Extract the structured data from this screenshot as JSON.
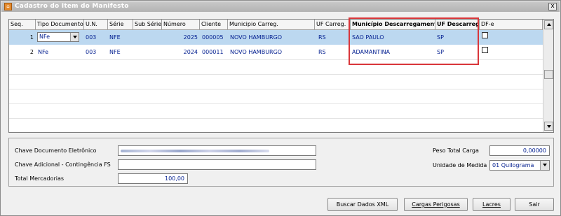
{
  "window": {
    "title": "Cadastro do Item do Manifesto",
    "close_label": "x",
    "app_icon_name": "app-house-icon"
  },
  "grid": {
    "columns": [
      {
        "key": "seq",
        "label": "Seq."
      },
      {
        "key": "tipo_documento",
        "label": "Tipo Documento"
      },
      {
        "key": "un",
        "label": "U.N."
      },
      {
        "key": "serie",
        "label": "Série"
      },
      {
        "key": "sub_serie",
        "label": "Sub Série"
      },
      {
        "key": "numero",
        "label": "Número"
      },
      {
        "key": "cliente",
        "label": "Cliente"
      },
      {
        "key": "municipio_carreg",
        "label": "Municipio Carreg."
      },
      {
        "key": "uf_carreg",
        "label": "UF Carreg."
      },
      {
        "key": "municipio_descarregamento",
        "label": "Município Descarregamento"
      },
      {
        "key": "uf_descarreg",
        "label": "UF Descarreg."
      },
      {
        "key": "dfe",
        "label": "DF-e"
      }
    ],
    "rows": [
      {
        "seq": "1",
        "tipo_documento": "NFe",
        "un": "003",
        "serie": "NFE",
        "sub_serie": "",
        "numero": "2025",
        "cliente": "000005",
        "municipio_carreg": "NOVO HAMBURGO",
        "uf_carreg": "RS",
        "municipio_descarregamento": "SAO PAULO",
        "uf_descarreg": "SP",
        "dfe": false
      },
      {
        "seq": "2",
        "tipo_documento": "NFe",
        "un": "003",
        "serie": "NFE",
        "sub_serie": "",
        "numero": "2024",
        "cliente": "000011",
        "municipio_carreg": "NOVO HAMBURGO",
        "uf_carreg": "RS",
        "municipio_descarregamento": "ADAMANTINA",
        "uf_descarreg": "SP",
        "dfe": false
      }
    ],
    "highlight_color": "#d9363a",
    "selected_row_color": "#bcd8f0"
  },
  "form": {
    "chave_label": "Chave Documento Eletrônico",
    "chave_value": "",
    "chave_adicional_label": "Chave Adicional - Contingência FS",
    "chave_adicional_value": "",
    "total_label": "Total Mercadorias",
    "total_value": "100,00",
    "peso_label": "Peso Total Carga",
    "peso_value": "0,00000",
    "unidade_label": "Unidade de Medida",
    "unidade_value": "01 Quilograma"
  },
  "buttons": {
    "buscar": "Buscar Dados XML",
    "cargas": "Cargas Perigosas",
    "lacres": "Lacres",
    "sair": "Sair"
  }
}
